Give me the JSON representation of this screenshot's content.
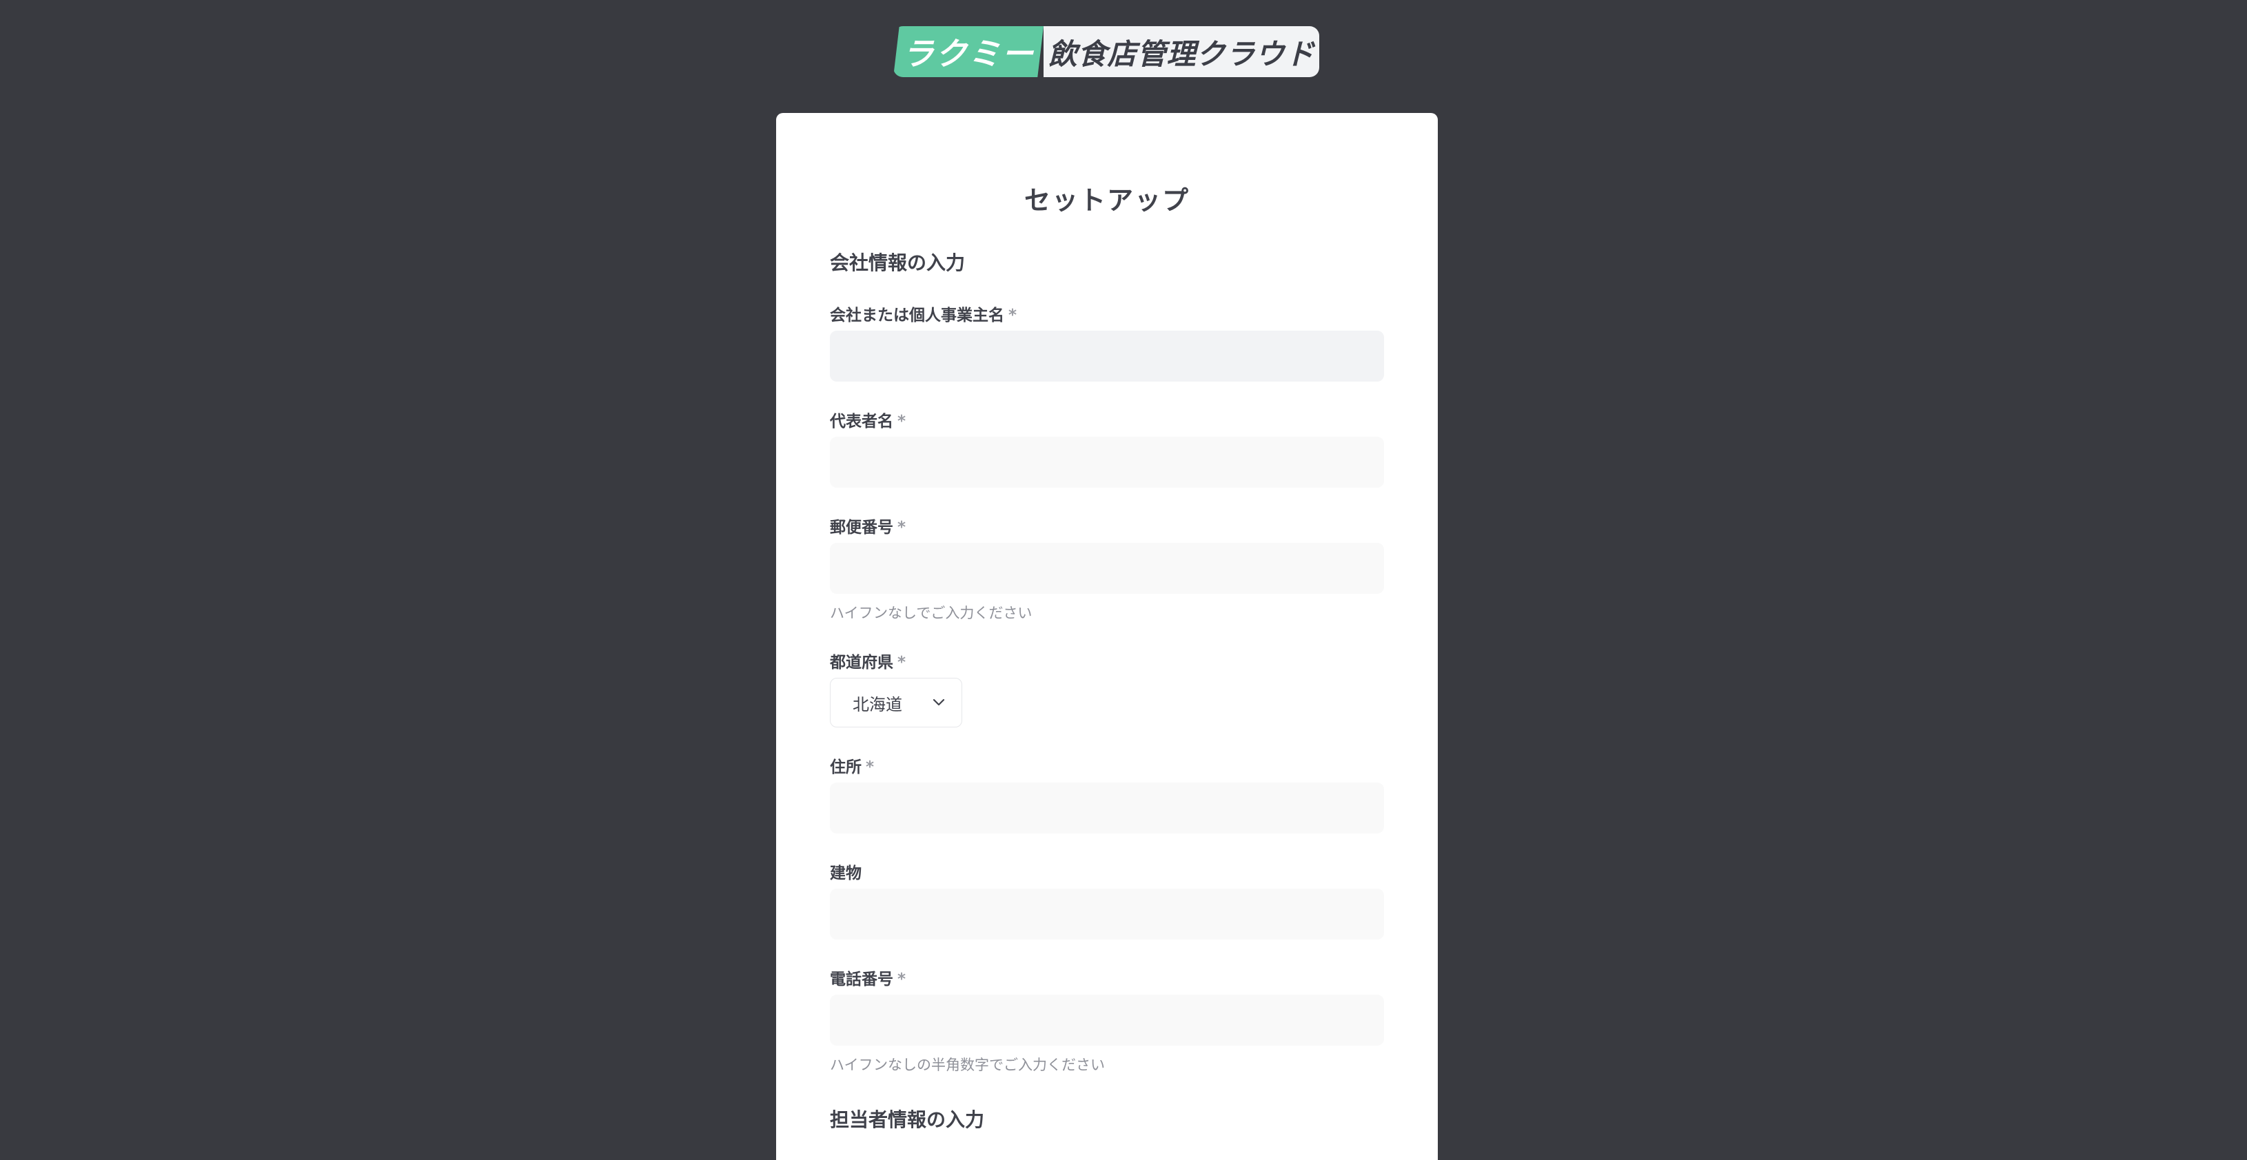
{
  "logo": {
    "brand": "ラクミー",
    "product": "飲食店管理クラウド"
  },
  "form": {
    "title": "セットアップ",
    "company_section": {
      "heading": "会社情報の入力",
      "required_mark": "*",
      "company_name": {
        "label": "会社または個人事業主名",
        "value": ""
      },
      "representative": {
        "label": "代表者名",
        "value": ""
      },
      "postal_code": {
        "label": "郵便番号",
        "value": "",
        "hint": "ハイフンなしでご入力ください"
      },
      "prefecture": {
        "label": "都道府県",
        "selected": "北海道"
      },
      "address": {
        "label": "住所",
        "value": ""
      },
      "building": {
        "label": "建物",
        "value": ""
      },
      "phone": {
        "label": "電話番号",
        "value": "",
        "hint": "ハイフンなしの半角数字でご入力ください"
      }
    },
    "contact_section": {
      "heading": "担当者情報の入力"
    }
  },
  "icons": {
    "prefecture_dropdown": "chevron-down-icon"
  },
  "colors": {
    "background": "#393a40",
    "brand_green": "#5fc9a1",
    "card": "#ffffff",
    "input_fill": "#f9f9f9"
  }
}
